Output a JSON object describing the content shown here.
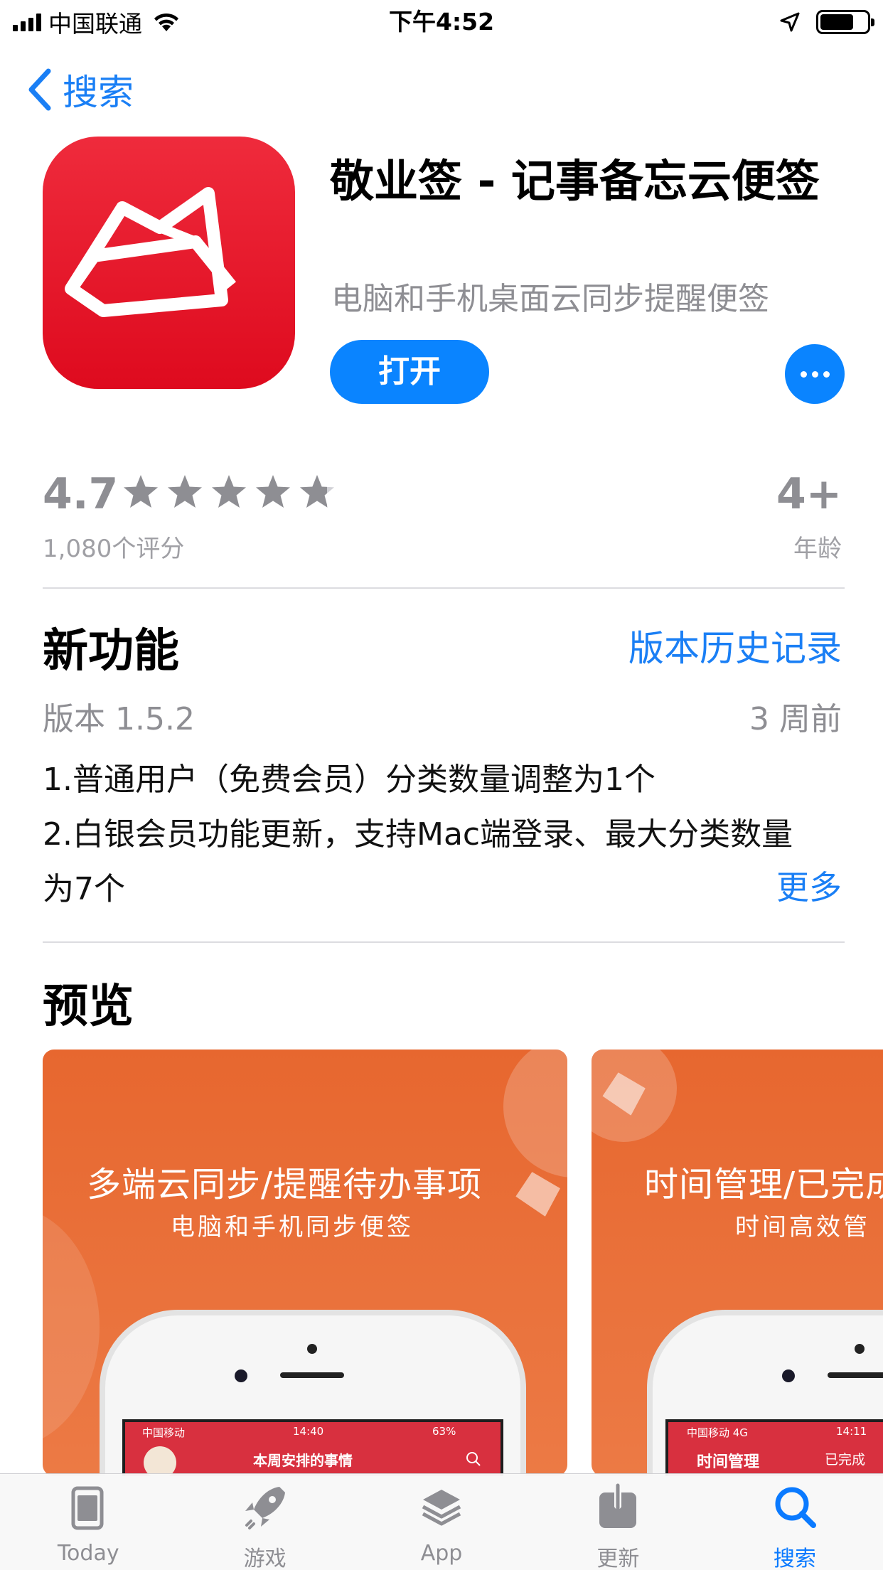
{
  "status_bar": {
    "carrier": "中国联通",
    "time": "下午4:52",
    "battery_level": 0.72
  },
  "nav": {
    "back_label": "搜索"
  },
  "app": {
    "title": "敬业签 - 记事备忘云便签",
    "subtitle": "电脑和手机桌面云同步提醒便签",
    "open_label": "打开",
    "icon_color": "#e0112a"
  },
  "ratings": {
    "score": "4.7",
    "stars": 4.7,
    "count_label": "1,080个评分",
    "age_value": "4+",
    "age_label": "年龄"
  },
  "whats_new": {
    "title": "新功能",
    "history_link": "版本历史记录",
    "version": "版本 1.5.2",
    "date": "3 周前",
    "notes": [
      "1.普通用户（免费会员）分类数量调整为1个",
      "2.白银会员功能更新，支持Mac端登录、最大分类数量为7个"
    ],
    "more_label": "更多"
  },
  "preview": {
    "title": "预览",
    "cards": [
      {
        "headline": "多端云同步/提醒待办事项",
        "sub": "电脑和手机同步便签",
        "screen_carrier": "中国移动",
        "screen_time": "14:40",
        "screen_battery": "63%",
        "screen_title": "本周安排的事情"
      },
      {
        "headline": "时间管理/已完成",
        "sub": "时间高效管",
        "screen_carrier": "中国移动  4G",
        "screen_time": "14:11",
        "screen_title": "时间管理",
        "screen_right": "已完成"
      }
    ]
  },
  "tab_bar": {
    "tabs": [
      {
        "label": "Today",
        "icon": "today-icon",
        "active": false
      },
      {
        "label": "游戏",
        "icon": "rocket-icon",
        "active": false
      },
      {
        "label": "App",
        "icon": "layers-icon",
        "active": false
      },
      {
        "label": "更新",
        "icon": "download-icon",
        "active": false
      },
      {
        "label": "搜索",
        "icon": "search-icon",
        "active": true
      }
    ],
    "accent": "#0a7aff",
    "inactive": "#8e8e93"
  }
}
